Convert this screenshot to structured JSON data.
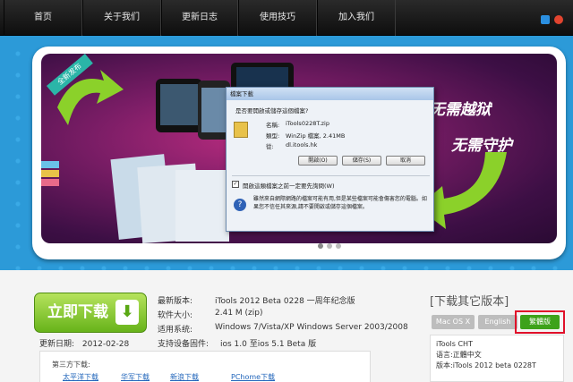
{
  "nav": {
    "items": [
      "首页",
      "关于我们",
      "更新日志",
      "使用技巧",
      "加入我们"
    ]
  },
  "banner": {
    "ribbon": "全新发布",
    "slogan1": "无需越狱",
    "slogan2": "无需守护"
  },
  "dialog": {
    "title": "檔案下載",
    "question": "是否要開啟或儲存這個檔案?",
    "name_label": "名稱:",
    "name_value": "iTools0228T.zip",
    "type_label": "類型:",
    "type_value": "WinZip 檔案, 2.41MB",
    "from_label": "從:",
    "from_value": "dl.itools.hk",
    "open_btn": "開啟(O)",
    "save_btn": "儲存(S)",
    "cancel_btn": "取消",
    "checkbox_label": "開啟這類檔案之前一定要先詢問(W)",
    "warning": "雖然來自網際網路的檔案可能有用,但是某些檔案可能會傷害您的電腦。如果您不信任其來源,請不要開啟或儲存這個檔案。"
  },
  "download": {
    "button": "立即下载"
  },
  "details": {
    "version_label": "最新版本:",
    "version_value": "iTools 2012 Beta 0228 一周年纪念版",
    "size_label": "软件大小:",
    "size_value": "2.41 M (zip)",
    "system_label": "适用系统:",
    "system_value": "Windows 7/Vista/XP     Windows Server 2003/2008",
    "devices_label": "支持设备固件:",
    "devices_value": "ios 1.0 至ios 5.1 Beta 版",
    "updated_label": "更新日期:",
    "updated_value": "2012-02-28"
  },
  "other": {
    "title": "[下载其它版本]",
    "lang_mac": "Mac OS X",
    "lang_en": "English",
    "lang_cht": "繁體版",
    "cht_name": "iTools CHT",
    "cht_lang": "语言:正體中文",
    "cht_version": "版本:iTools 2012 beta 0228T"
  },
  "third_party": {
    "title": "第三方下载:",
    "links": [
      "太平洋下载",
      "华军下载",
      "新浪下载",
      "PChome下载"
    ]
  },
  "colors": {
    "banner_blue": "#2c9ad8",
    "download_green": "#67b31a",
    "highlight_red": "#e0102a"
  }
}
